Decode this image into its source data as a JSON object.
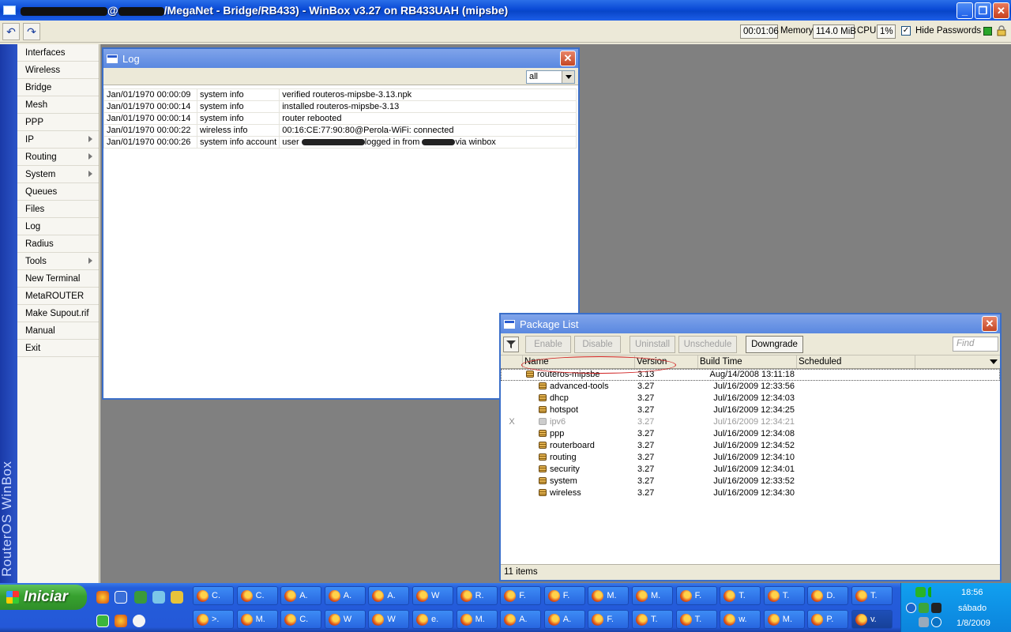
{
  "titlebar": {
    "title": "MegaNet - Bridge/RB433) - WinBox v3.27 on RB433UAH (mipsbe)",
    "title_prefix": "@",
    "title_paren": "/"
  },
  "toolbar": {
    "uptime": "00:01:06",
    "memory_label": "Memory:",
    "memory_value": "114.0 MiB",
    "cpu_label": "CPU:",
    "cpu_value": "1%",
    "hide_passwords_label": "Hide Passwords",
    "hide_passwords_checked": true
  },
  "sidebar": {
    "brand": "RouterOS WinBox",
    "items": [
      {
        "label": "Interfaces",
        "submenu": false
      },
      {
        "label": "Wireless",
        "submenu": false
      },
      {
        "label": "Bridge",
        "submenu": false
      },
      {
        "label": "Mesh",
        "submenu": false
      },
      {
        "label": "PPP",
        "submenu": false
      },
      {
        "label": "IP",
        "submenu": true
      },
      {
        "label": "Routing",
        "submenu": true
      },
      {
        "label": "System",
        "submenu": true
      },
      {
        "label": "Queues",
        "submenu": false
      },
      {
        "label": "Files",
        "submenu": false
      },
      {
        "label": "Log",
        "submenu": false
      },
      {
        "label": "Radius",
        "submenu": false
      },
      {
        "label": "Tools",
        "submenu": true
      },
      {
        "label": "New Terminal",
        "submenu": false
      },
      {
        "label": "MetaROUTER",
        "submenu": false
      },
      {
        "label": "Make Supout.rif",
        "submenu": false
      },
      {
        "label": "Manual",
        "submenu": false
      },
      {
        "label": "Exit",
        "submenu": false
      }
    ]
  },
  "log_window": {
    "title": "Log",
    "filter_value": "all",
    "entries": [
      {
        "time": "Jan/01/1970 00:00:09",
        "topics": "system info",
        "message": "verified routeros-mipsbe-3.13.npk"
      },
      {
        "time": "Jan/01/1970 00:00:14",
        "topics": "system info",
        "message": "installed routeros-mipsbe-3.13"
      },
      {
        "time": "Jan/01/1970 00:00:14",
        "topics": "system info",
        "message": "router rebooted"
      },
      {
        "time": "Jan/01/1970 00:00:22",
        "topics": "wireless info",
        "message": "00:16:CE:77:90:80@Perola-WiFi: connected"
      },
      {
        "time": "Jan/01/1970 00:00:26",
        "topics": "system info account",
        "message_parts": [
          "user ",
          "logged in from ",
          "via winbox"
        ]
      }
    ]
  },
  "package_window": {
    "title": "Package List",
    "buttons": {
      "enable": "Enable",
      "disable": "Disable",
      "uninstall": "Uninstall",
      "unschedule": "Unschedule",
      "downgrade": "Downgrade"
    },
    "find_placeholder": "Find",
    "columns": [
      "Name",
      "Version",
      "Build Time",
      "Scheduled"
    ],
    "rows": [
      {
        "flag": "",
        "name": "routeros-mipsbe",
        "version": "3.13",
        "build": "Aug/14/2008 13:11:18",
        "scheduled": "",
        "indent": 0,
        "disabled": false
      },
      {
        "flag": "",
        "name": "advanced-tools",
        "version": "3.27",
        "build": "Jul/16/2009 12:33:56",
        "scheduled": "",
        "indent": 1,
        "disabled": false
      },
      {
        "flag": "",
        "name": "dhcp",
        "version": "3.27",
        "build": "Jul/16/2009 12:34:03",
        "scheduled": "",
        "indent": 1,
        "disabled": false
      },
      {
        "flag": "",
        "name": "hotspot",
        "version": "3.27",
        "build": "Jul/16/2009 12:34:25",
        "scheduled": "",
        "indent": 1,
        "disabled": false
      },
      {
        "flag": "X",
        "name": "ipv6",
        "version": "3.27",
        "build": "Jul/16/2009 12:34:21",
        "scheduled": "",
        "indent": 1,
        "disabled": true
      },
      {
        "flag": "",
        "name": "ppp",
        "version": "3.27",
        "build": "Jul/16/2009 12:34:08",
        "scheduled": "",
        "indent": 1,
        "disabled": false
      },
      {
        "flag": "",
        "name": "routerboard",
        "version": "3.27",
        "build": "Jul/16/2009 12:34:52",
        "scheduled": "",
        "indent": 1,
        "disabled": false
      },
      {
        "flag": "",
        "name": "routing",
        "version": "3.27",
        "build": "Jul/16/2009 12:34:10",
        "scheduled": "",
        "indent": 1,
        "disabled": false
      },
      {
        "flag": "",
        "name": "security",
        "version": "3.27",
        "build": "Jul/16/2009 12:34:01",
        "scheduled": "",
        "indent": 1,
        "disabled": false
      },
      {
        "flag": "",
        "name": "system",
        "version": "3.27",
        "build": "Jul/16/2009 12:33:52",
        "scheduled": "",
        "indent": 1,
        "disabled": false
      },
      {
        "flag": "",
        "name": "wireless",
        "version": "3.27",
        "build": "Jul/16/2009 12:34:30",
        "scheduled": "",
        "indent": 1,
        "disabled": false
      }
    ],
    "status": "11 items"
  },
  "taskbar": {
    "start_label": "Iniciar",
    "row1": [
      "C.",
      "C.",
      "A.",
      "A.",
      "A.",
      "W",
      "R.",
      "F.",
      "F.",
      "M.",
      "M.",
      "F.",
      "T.",
      "T.",
      "D.",
      "T."
    ],
    "row2": [
      ">.",
      "M.",
      "C.",
      "W",
      "W",
      "e.",
      "M.",
      "A.",
      "A.",
      "F.",
      "T.",
      "T.",
      "w.",
      "M.",
      "P.",
      "v."
    ],
    "active_row2_index": 15,
    "clock": {
      "time": "18:56",
      "day": "sábado",
      "date": "1/8/2009"
    }
  }
}
